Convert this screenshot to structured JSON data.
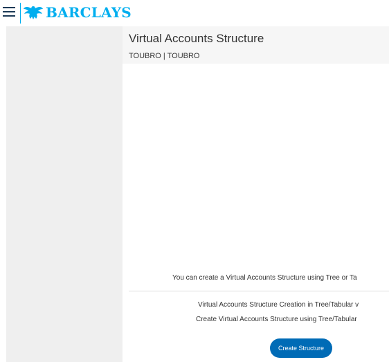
{
  "header": {
    "brand": "BARCLAYS",
    "menu_icon": "hamburger-menu-icon",
    "logo_icon": "eagle-icon"
  },
  "page": {
    "title": "Virtual Accounts Structure",
    "subtitle": "TOUBRO | TOUBRO"
  },
  "content": {
    "info": "You can create a Virtual Accounts Structure using Tree or Ta",
    "line1": "Virtual Accounts Structure Creation in Tree/Tabular v",
    "line2": "Create Virtual Accounts Structure using Tree/Tabular",
    "button_label": "Create Structure"
  },
  "colors": {
    "brand": "#00aeef",
    "button": "#006bb6",
    "sidebar": "#efefef",
    "menu": "#1c3a57"
  }
}
